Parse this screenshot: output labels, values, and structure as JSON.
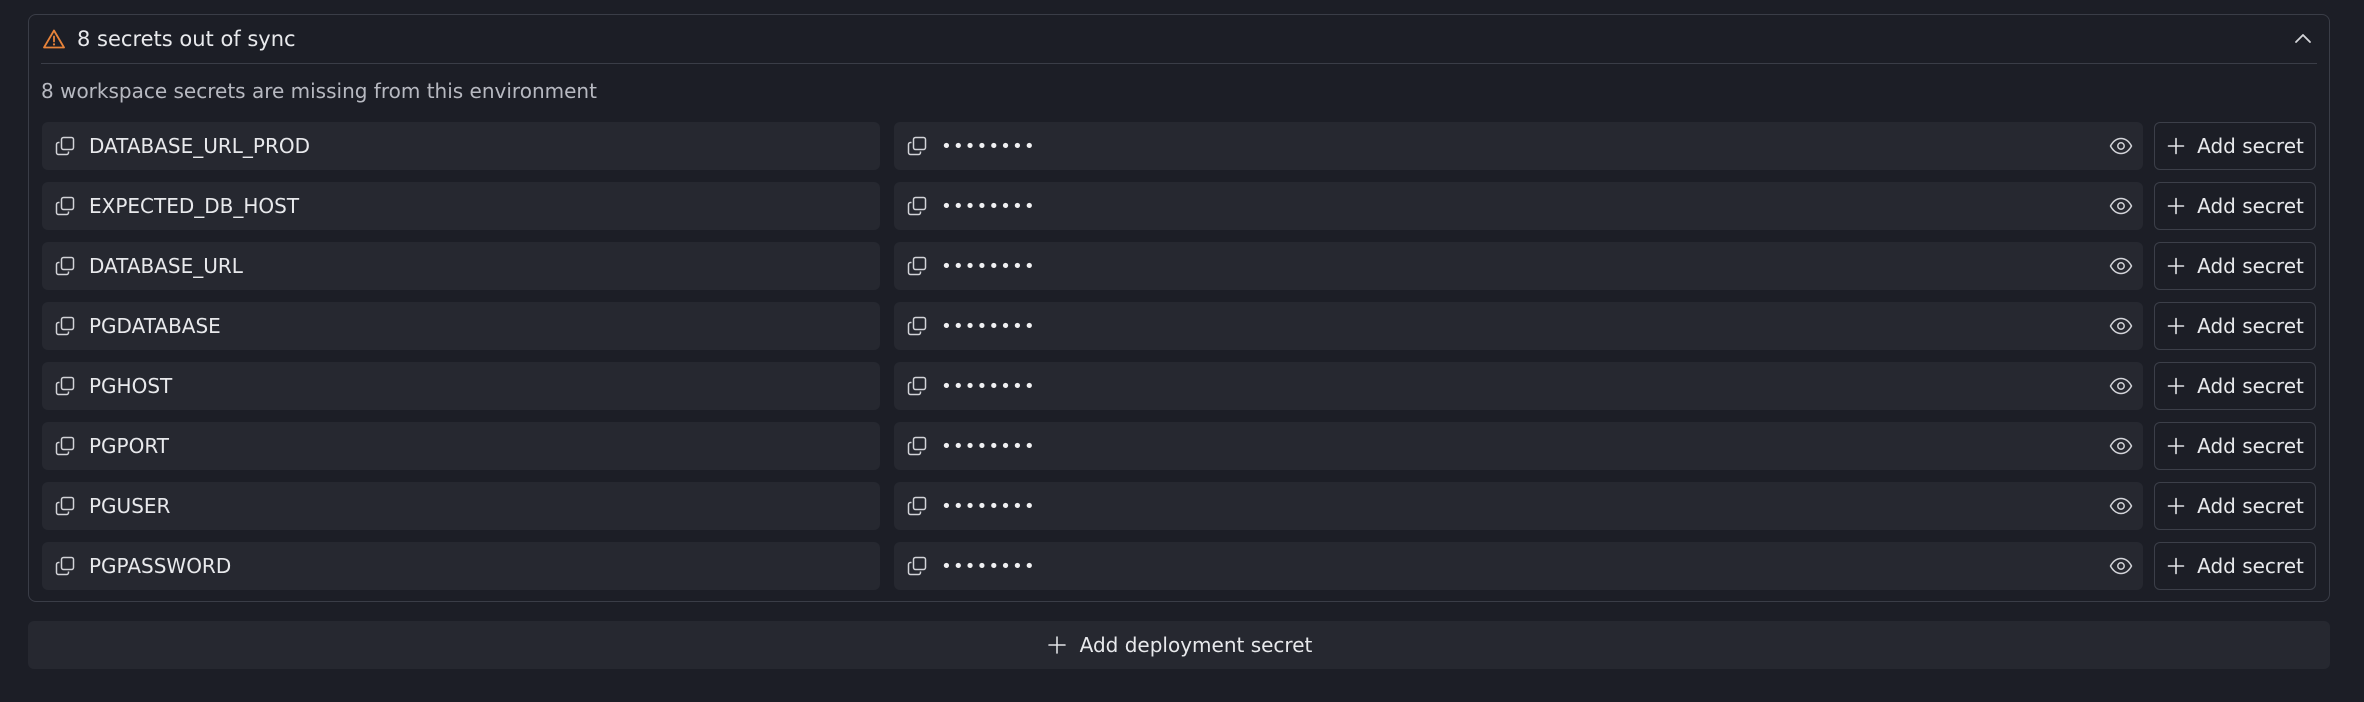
{
  "panel": {
    "title": "8 secrets out of sync",
    "subtitle": "8 workspace secrets are missing from this environment",
    "warning_color": "#e8833a"
  },
  "secrets": [
    {
      "name": "DATABASE_URL_PROD",
      "masked_value": "••••••••",
      "action_label": "Add secret"
    },
    {
      "name": "EXPECTED_DB_HOST",
      "masked_value": "••••••••",
      "action_label": "Add secret"
    },
    {
      "name": "DATABASE_URL",
      "masked_value": "••••••••",
      "action_label": "Add secret"
    },
    {
      "name": "PGDATABASE",
      "masked_value": "••••••••",
      "action_label": "Add secret"
    },
    {
      "name": "PGHOST",
      "masked_value": "••••••••",
      "action_label": "Add secret"
    },
    {
      "name": "PGPORT",
      "masked_value": "••••••••",
      "action_label": "Add secret"
    },
    {
      "name": "PGUSER",
      "masked_value": "••••••••",
      "action_label": "Add secret"
    },
    {
      "name": "PGPASSWORD",
      "masked_value": "••••••••",
      "action_label": "Add secret"
    }
  ],
  "footer": {
    "add_deployment_label": "Add deployment secret"
  },
  "icons": {
    "warning": "warning-triangle-icon",
    "collapse": "chevron-up-icon",
    "copy": "copy-icon",
    "reveal": "eye-icon",
    "add": "plus-icon"
  }
}
